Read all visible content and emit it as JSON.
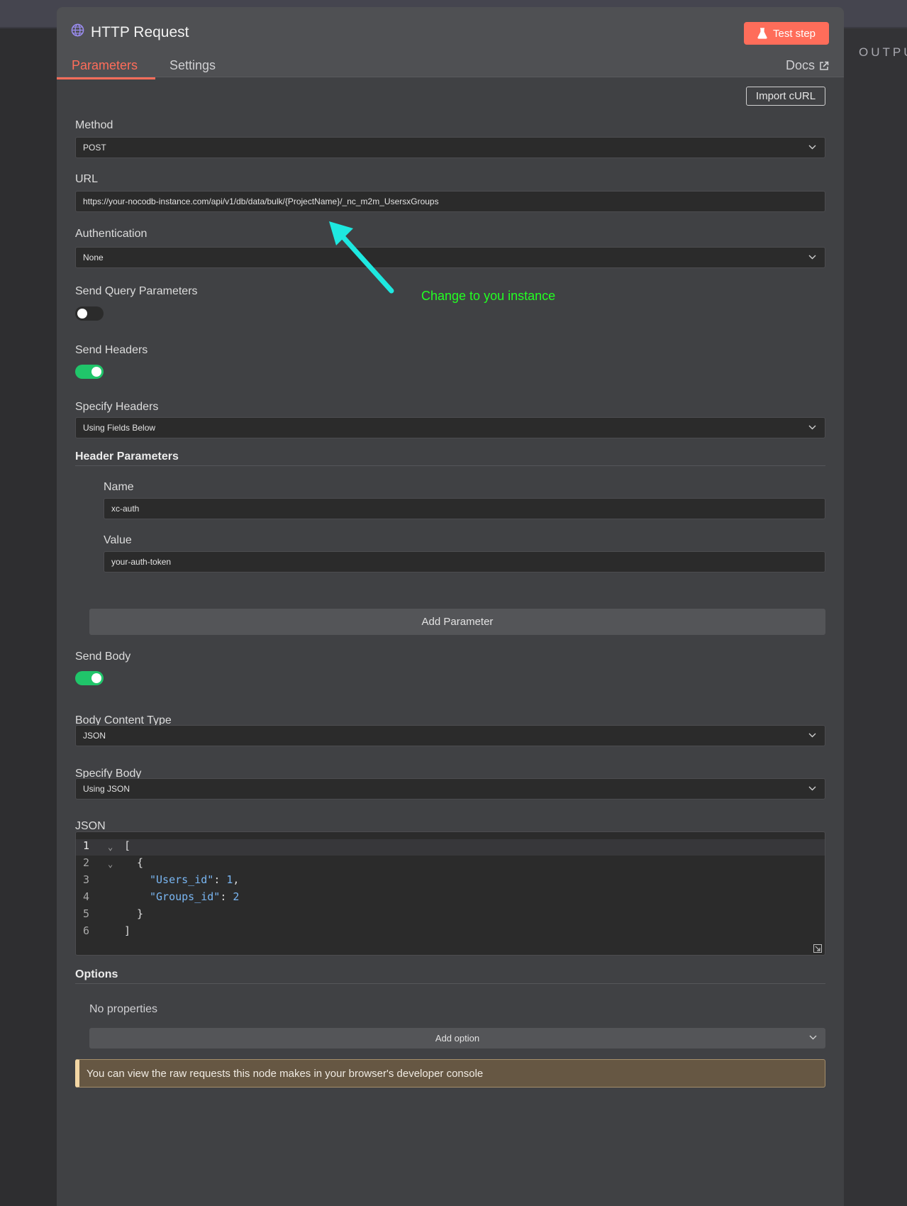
{
  "output_label": "OUTPU",
  "node": {
    "title": "HTTP Request",
    "test_step_label": "Test step"
  },
  "tabs": {
    "parameters": "Parameters",
    "settings": "Settings",
    "docs": "Docs"
  },
  "import_curl_label": "Import cURL",
  "fields": {
    "method": {
      "label": "Method",
      "value": "POST"
    },
    "url": {
      "label": "URL",
      "value": "https://your-nocodb-instance.com/api/v1/db/data/bulk/{ProjectName}/_nc_m2m_UsersxGroups"
    },
    "authentication": {
      "label": "Authentication",
      "value": "None"
    },
    "send_query_parameters": {
      "label": "Send Query Parameters",
      "enabled": false
    },
    "send_headers": {
      "label": "Send Headers",
      "enabled": true
    },
    "specify_headers": {
      "label": "Specify Headers",
      "value": "Using Fields Below"
    },
    "send_body": {
      "label": "Send Body",
      "enabled": true
    },
    "body_content_type": {
      "label": "Body Content Type",
      "value": "JSON"
    },
    "specify_body": {
      "label": "Specify Body",
      "value": "Using JSON"
    },
    "json_label": "JSON"
  },
  "header_parameters": {
    "title": "Header Parameters",
    "name_label": "Name",
    "name_value": "xc-auth",
    "value_label": "Value",
    "value_value": "your-auth-token",
    "add_button": "Add Parameter"
  },
  "json_editor": {
    "line_numbers": [
      "1",
      "2",
      "3",
      "4",
      "5",
      "6"
    ],
    "open_bracket": "[",
    "open_brace": "{",
    "key1": "\"Users_id\"",
    "val1": "1",
    "key2": "\"Groups_id\"",
    "val2": "2",
    "close_brace": "}",
    "close_bracket": "]"
  },
  "options": {
    "title": "Options",
    "empty_text": "No properties",
    "add_option": "Add option"
  },
  "notice": "You can view the raw requests this node makes in your browser's developer console",
  "annotation": "Change to you instance",
  "colors": {
    "accent": "#ff6d5a",
    "toggle_on": "#20c56a",
    "annotation": "#22ff22",
    "arrow": "#1ee8e0"
  }
}
